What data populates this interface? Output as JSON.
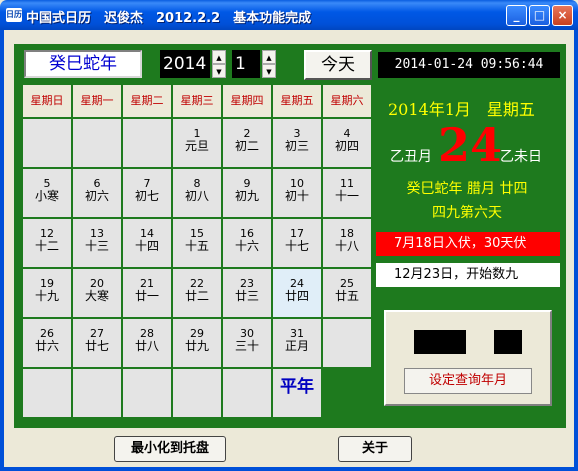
{
  "window": {
    "title": "中国式日历　迟俊杰　2012.2.2　基本功能完成",
    "icon_label": "日历",
    "minimize": "_",
    "maximize": "□",
    "close": "×"
  },
  "toolbar": {
    "zodiac_year": "癸巳蛇年",
    "year_value": "2014",
    "month_value": "1",
    "spin_up": "▲",
    "spin_down": "▼",
    "today_label": "今天",
    "datetime": "2014-01-24 09:56:44"
  },
  "weekdays": [
    "星期日",
    "星期一",
    "星期二",
    "星期三",
    "星期四",
    "星期五",
    "星期六"
  ],
  "calendar": [
    {
      "day": "",
      "lunar": ""
    },
    {
      "day": "",
      "lunar": ""
    },
    {
      "day": "",
      "lunar": ""
    },
    {
      "day": "1",
      "lunar": "元旦"
    },
    {
      "day": "2",
      "lunar": "初二"
    },
    {
      "day": "3",
      "lunar": "初三"
    },
    {
      "day": "4",
      "lunar": "初四"
    },
    {
      "day": "5",
      "lunar": "小寒"
    },
    {
      "day": "6",
      "lunar": "初六"
    },
    {
      "day": "7",
      "lunar": "初七"
    },
    {
      "day": "8",
      "lunar": "初八"
    },
    {
      "day": "9",
      "lunar": "初九"
    },
    {
      "day": "10",
      "lunar": "初十"
    },
    {
      "day": "11",
      "lunar": "十一"
    },
    {
      "day": "12",
      "lunar": "十二"
    },
    {
      "day": "13",
      "lunar": "十三"
    },
    {
      "day": "14",
      "lunar": "十四"
    },
    {
      "day": "15",
      "lunar": "十五"
    },
    {
      "day": "16",
      "lunar": "十六"
    },
    {
      "day": "17",
      "lunar": "十七"
    },
    {
      "day": "18",
      "lunar": "十八"
    },
    {
      "day": "19",
      "lunar": "十九"
    },
    {
      "day": "20",
      "lunar": "大寒"
    },
    {
      "day": "21",
      "lunar": "廿一"
    },
    {
      "day": "22",
      "lunar": "廿二"
    },
    {
      "day": "23",
      "lunar": "廿三"
    },
    {
      "day": "24",
      "lunar": "廿四",
      "selected": true
    },
    {
      "day": "25",
      "lunar": "廿五"
    },
    {
      "day": "26",
      "lunar": "廿六"
    },
    {
      "day": "27",
      "lunar": "廿七"
    },
    {
      "day": "28",
      "lunar": "廿八"
    },
    {
      "day": "29",
      "lunar": "廿九"
    },
    {
      "day": "30",
      "lunar": "三十"
    },
    {
      "day": "31",
      "lunar": "正月"
    },
    {
      "day": "",
      "lunar": ""
    },
    {
      "day": "",
      "lunar": ""
    },
    {
      "day": "",
      "lunar": ""
    },
    {
      "day": "",
      "lunar": ""
    },
    {
      "day": "",
      "lunar": ""
    },
    {
      "day": "",
      "lunar": ""
    },
    {
      "day": "",
      "lunar": ""
    }
  ],
  "leap_label": "平年",
  "info": {
    "date_line": "2014年1月　星期五",
    "big_day": "24",
    "ganzhi_month": "乙丑月",
    "ganzhi_day": "乙未日",
    "lunar_line": "癸巳蛇年 腊月 廿四",
    "term_line": "四九第六天",
    "alert": "7月18日入伏，30天伏",
    "notice": "12月23日，开始数九"
  },
  "query": {
    "button_label": "设定查询年月"
  },
  "bottom": {
    "minimize_tray": "最小化到托盘",
    "about": "关于"
  }
}
